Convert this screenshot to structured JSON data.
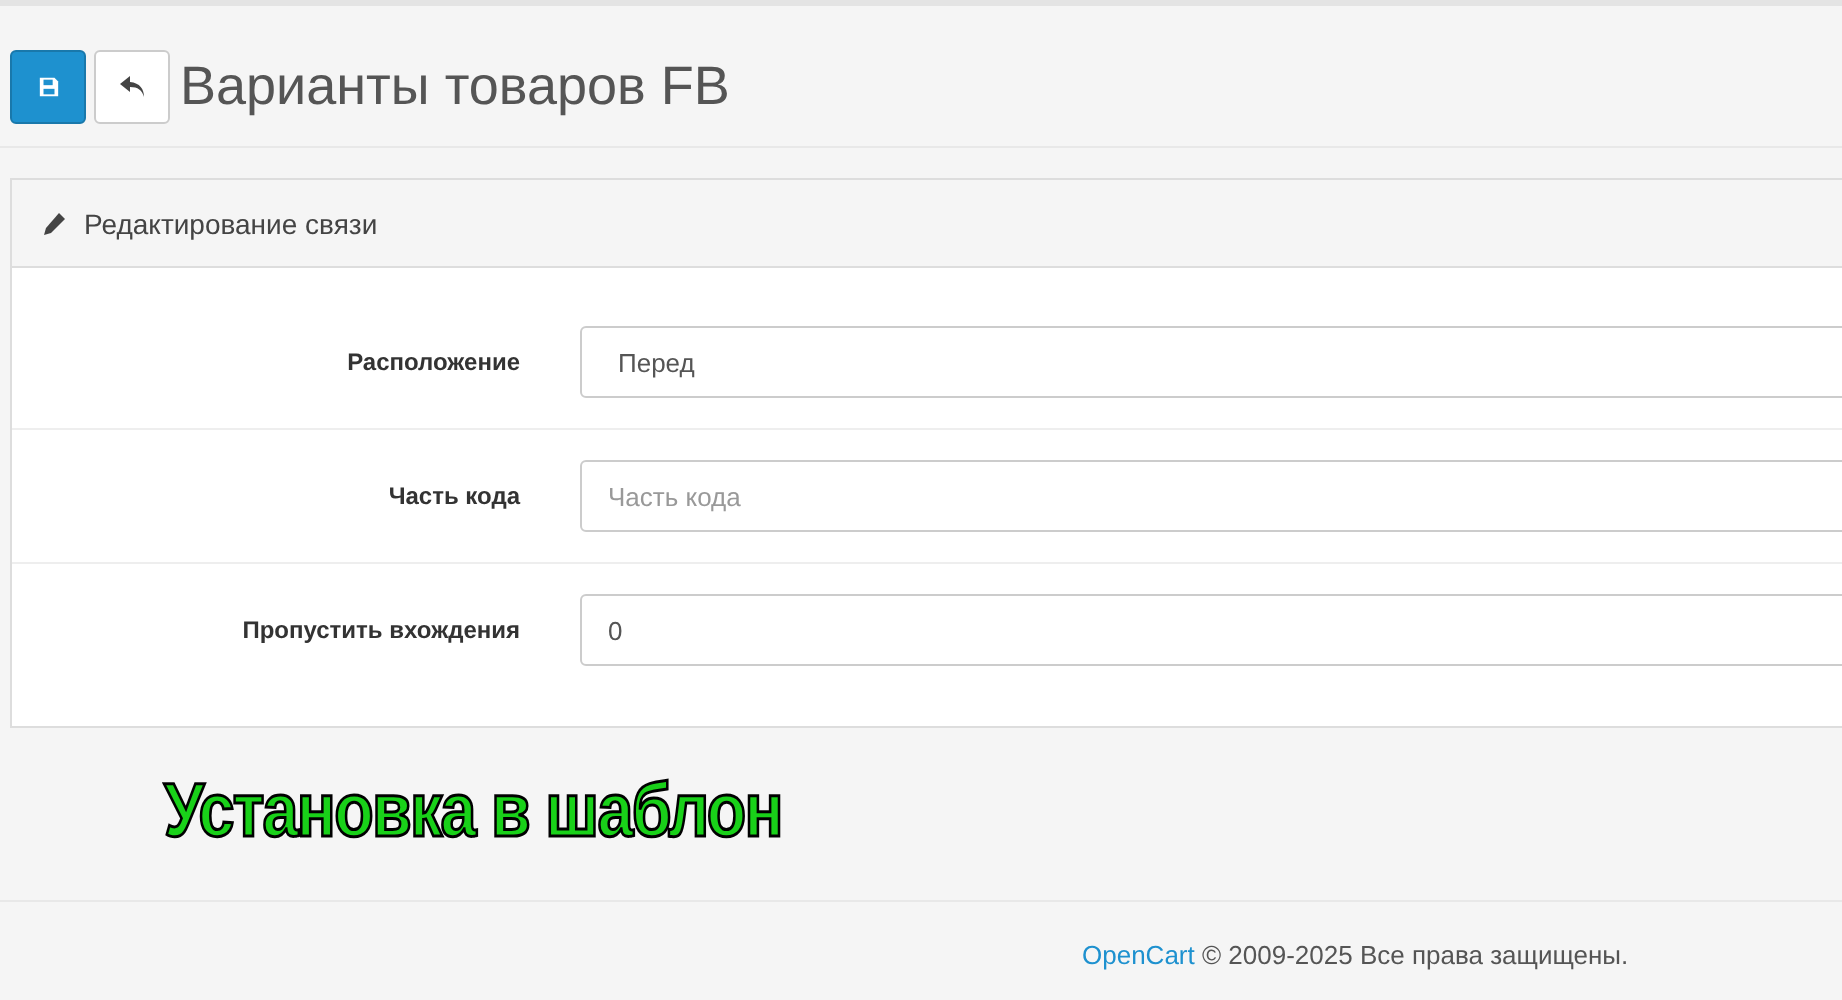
{
  "page_header": {
    "title": "Варианты товаров FB"
  },
  "panel": {
    "title": "Редактирование связи",
    "fields": [
      {
        "kind": "select",
        "label": "Расположение",
        "value": "Перед"
      },
      {
        "kind": "text",
        "label": "Часть кода",
        "placeholder": "Часть кода"
      },
      {
        "kind": "text",
        "label": "Пропустить вхождения",
        "value": "0"
      }
    ]
  },
  "caption": "Установка в шаблон",
  "footer": {
    "link": "OpenCart",
    "text": "© 2009-2025 Все права защищены."
  }
}
